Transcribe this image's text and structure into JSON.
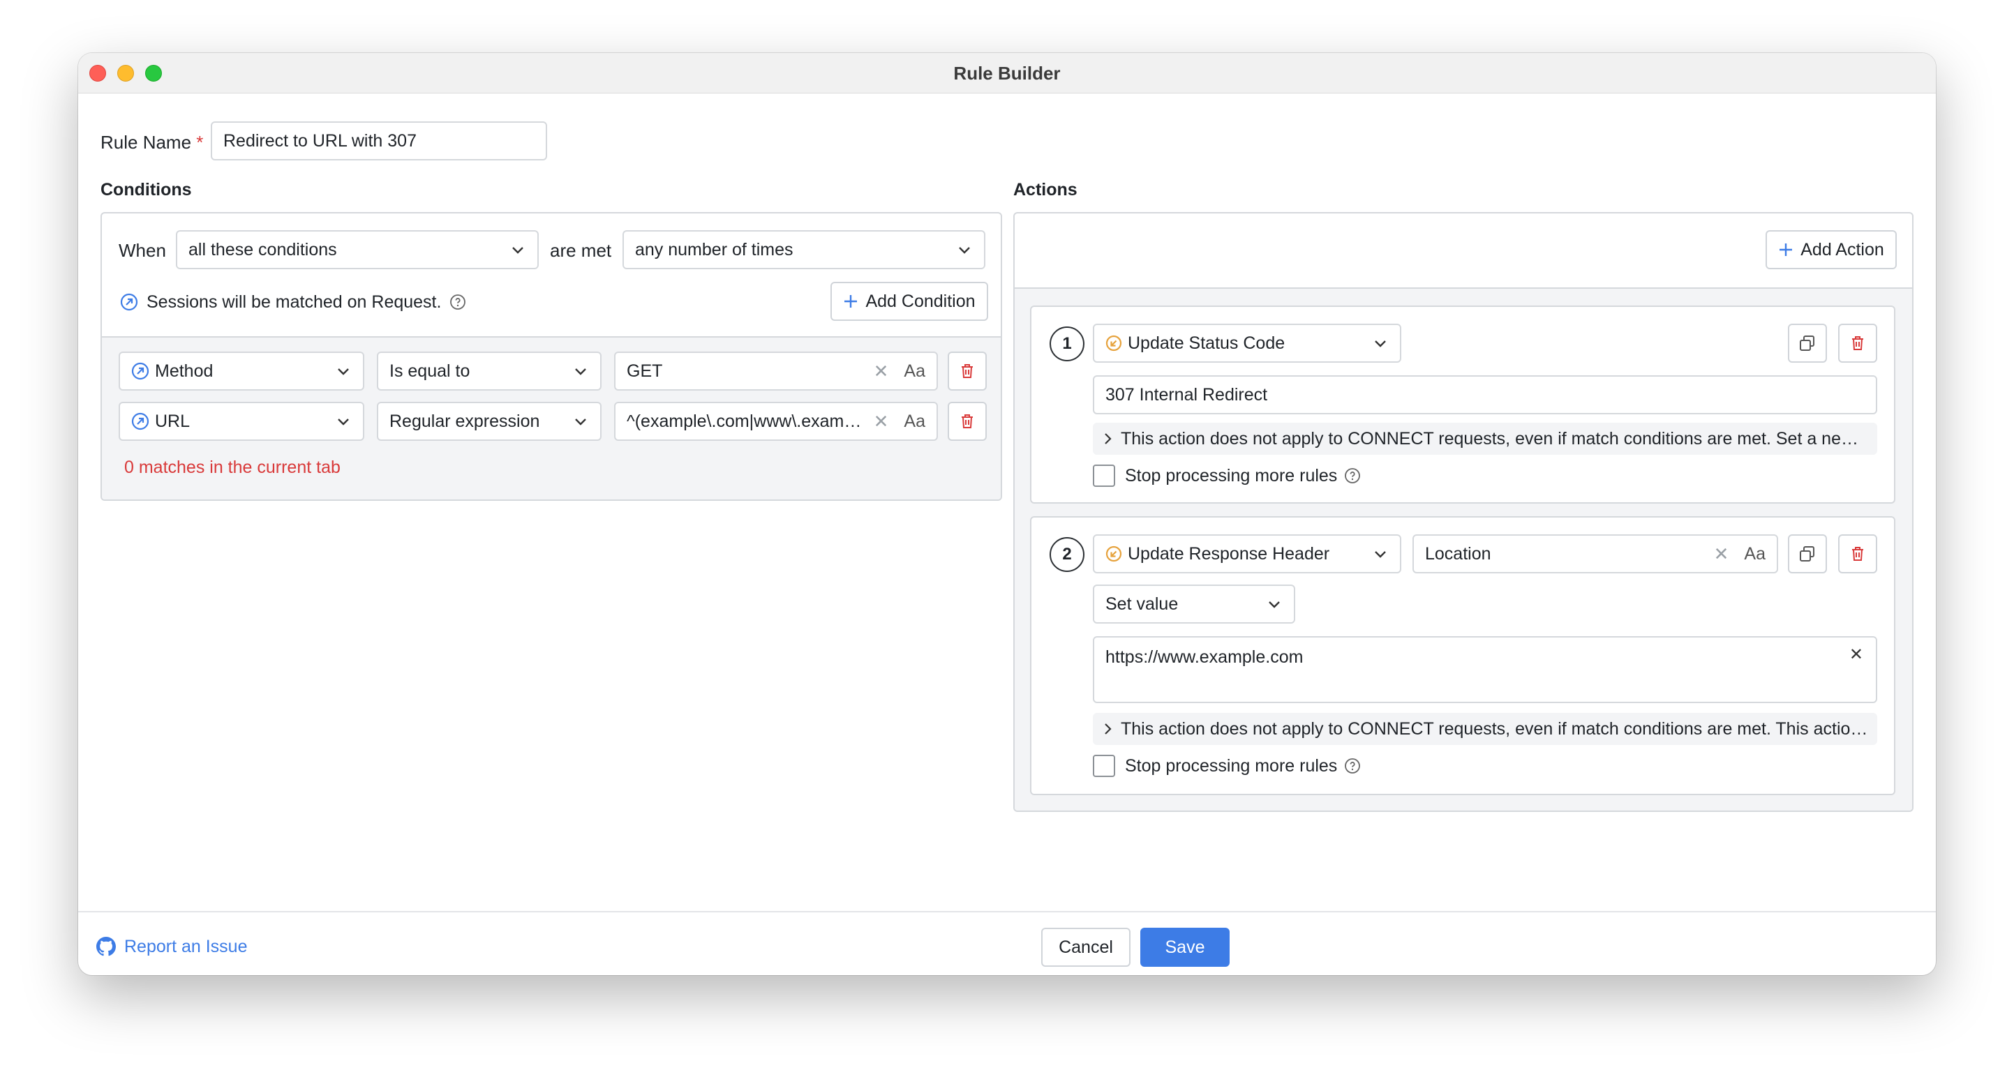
{
  "window": {
    "title": "Rule Builder"
  },
  "rule_name": {
    "label": "Rule Name",
    "required_mark": "*",
    "value": "Redirect to URL with 307"
  },
  "conditions": {
    "title": "Conditions",
    "when_label": "When",
    "match_mode": "all these conditions",
    "are_met_label": "are met",
    "frequency": "any number of times",
    "sessions_note": "Sessions will be matched on Request.",
    "add_condition_label": "Add Condition",
    "rows": [
      {
        "field": "Method",
        "operator": "Is equal to",
        "value": "GET",
        "case_toggle": "Aa"
      },
      {
        "field": "URL",
        "operator": "Regular expression",
        "value": "^(example\\.com|www\\.example\\.com)",
        "case_toggle": "Aa"
      }
    ],
    "matches_text": "0 matches in the current tab"
  },
  "actions": {
    "title": "Actions",
    "add_action_label": "Add Action",
    "items": [
      {
        "number": "1",
        "type": "Update Status Code",
        "value": "307 Internal Redirect",
        "note": "This action does not apply to CONNECT requests, even if match conditions are met. Set a new status code for the matched response.",
        "stop_label": "Stop processing more rules"
      },
      {
        "number": "2",
        "type": "Update Response Header",
        "header_name": "Location",
        "case_toggle": "Aa",
        "mode": "Set value",
        "value": "https://www.example.com",
        "note": "This action does not apply to CONNECT requests, even if match conditions are met. This action updates the response header.",
        "stop_label": "Stop processing more rules"
      }
    ]
  },
  "footer": {
    "report_label": "Report an Issue",
    "cancel_label": "Cancel",
    "save_label": "Save"
  },
  "colors": {
    "accent": "#3d7ce6",
    "danger": "#d93a3a",
    "orange_icon": "#e6a23c"
  }
}
